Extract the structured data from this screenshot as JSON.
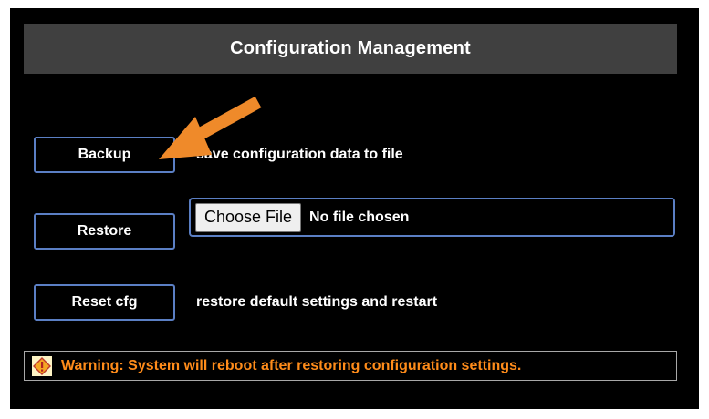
{
  "title": "Configuration Management",
  "backup": {
    "button_label": "Backup",
    "description": "save configuration data to file"
  },
  "restore": {
    "button_label": "Restore",
    "choose_file_label": "Choose File",
    "file_status": "No file chosen"
  },
  "reset": {
    "button_label": "Reset cfg",
    "description": "restore default settings and restart"
  },
  "warning": {
    "text": "Warning: System will reboot after restoring configuration settings.",
    "icon": "warning-icon"
  },
  "colors": {
    "panel_background": "#000000",
    "title_bar": "#404040",
    "button_border": "#5b7fc4",
    "warning_text": "#ff8c1a",
    "annotation_arrow": "#ef8a2a"
  }
}
